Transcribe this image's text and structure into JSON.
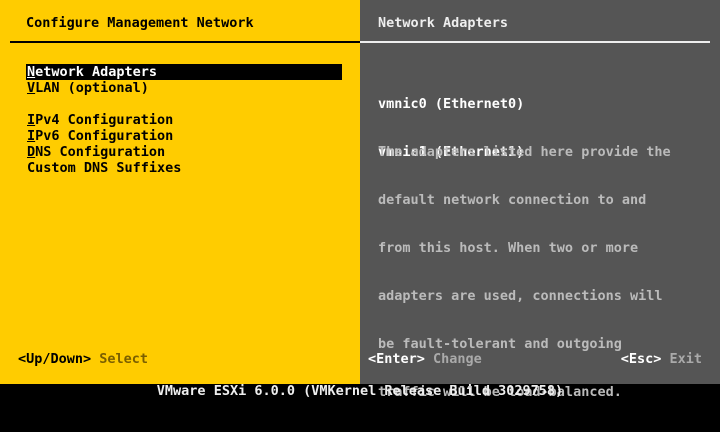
{
  "left_pane": {
    "title": "Configure Management Network",
    "menu": [
      {
        "hotkey": "N",
        "rest": "etwork Adapters",
        "selected": true
      },
      {
        "hotkey": "V",
        "rest": "LAN (optional)",
        "selected": false
      },
      {
        "hotkey": "I",
        "rest": "Pv4 Configuration",
        "selected": false
      },
      {
        "hotkey": "I",
        "rest": "Pv6 Configuration",
        "selected": false
      },
      {
        "hotkey": "D",
        "rest": "NS Configuration",
        "selected": false
      },
      {
        "hotkey": "",
        "rest": "Custom DNS Suffixes",
        "selected": false
      }
    ],
    "footer": {
      "key": "<Up/Down>",
      "action": "Select"
    }
  },
  "right_pane": {
    "title": "Network Adapters",
    "adapters": [
      "vmnic0 (Ethernet0)",
      "vmnic1 (Ethernet1)"
    ],
    "description_lines": [
      "The adapters listed here provide the",
      "default network connection to and",
      "from this host. When two or more",
      "adapters are used, connections will",
      "be fault-tolerant and outgoing",
      "traffic will be load-balanced."
    ],
    "footer": {
      "enter_key": "<Enter>",
      "enter_action": "Change",
      "esc_key": "<Esc>",
      "esc_action": "Exit"
    }
  },
  "status_bar": "VMware ESXi 6.0.0 (VMKernel Release Build 3029758)",
  "colors": {
    "left_background": "#FFCC00",
    "right_background": "#555555",
    "status_background": "#000000",
    "selection_background": "#000000"
  }
}
